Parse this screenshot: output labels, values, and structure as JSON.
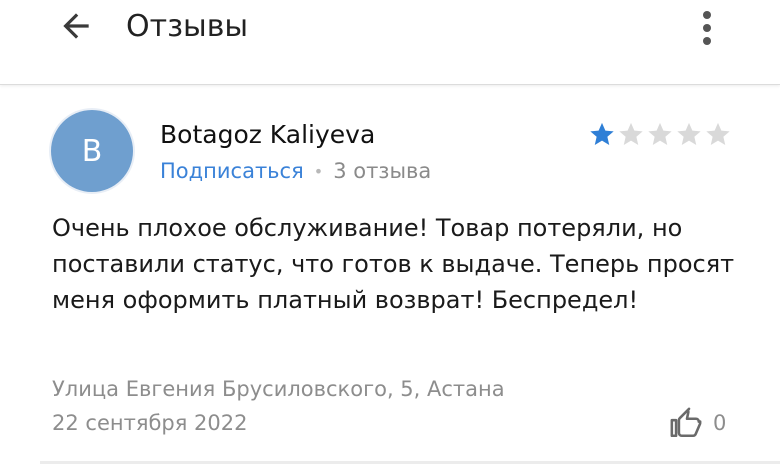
{
  "header": {
    "title": "Отзывы",
    "back_icon": "arrow-left-icon",
    "menu_icon": "more-vertical-icon"
  },
  "review": {
    "avatar_letter": "B",
    "avatar_color": "#6f9fcf",
    "author": "Botagoz Kaliyeva",
    "subscribe_label": "Подписаться",
    "separator": "•",
    "reviews_count": "3 отзыва",
    "rating": 1,
    "rating_max": 5,
    "text": "Очень плохое обслуживание! Товар потеряли, но поставили статус, что готов к выдаче. Теперь просят меня оформить платный возврат! Беспредел!",
    "address": "Улица Евгения Брусиловского, 5, Астана",
    "date": "22 сентября 2022",
    "like_icon": "thumbs-up-icon",
    "likes": "0"
  },
  "colors": {
    "accent": "#3a82d8",
    "star_active": "#2f7fd6",
    "star_inactive": "#d9d9d9",
    "muted_text": "#8d8d8d"
  }
}
